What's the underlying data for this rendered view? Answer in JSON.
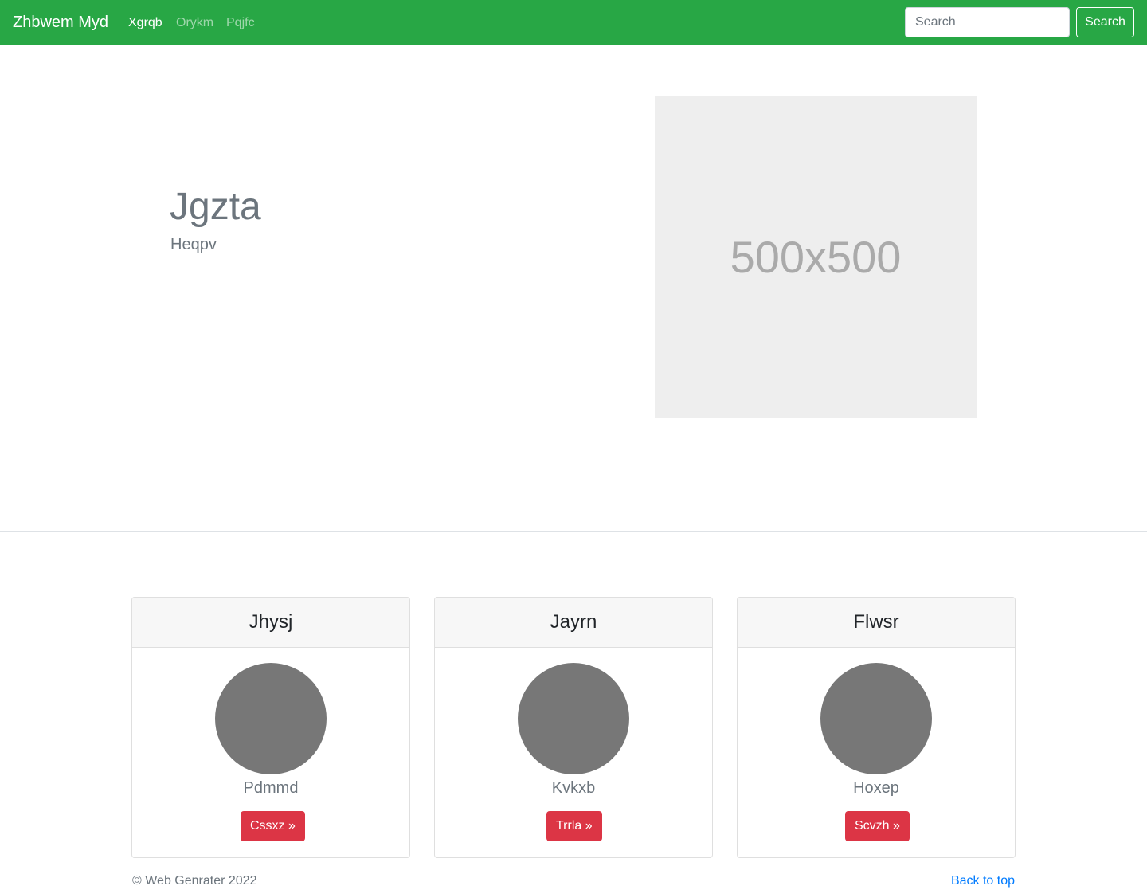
{
  "navbar": {
    "brand": "Zhbwem Myd",
    "links": [
      {
        "label": "Xgrqb",
        "active": true
      },
      {
        "label": "Orykm",
        "active": false
      },
      {
        "label": "Pqjfc",
        "active": false
      }
    ],
    "search_placeholder": "Search",
    "search_button": "Search",
    "color": "#28a745"
  },
  "hero": {
    "title": "Jgzta",
    "subtitle": "Heqpv",
    "image_label": "500x500"
  },
  "cards": [
    {
      "title": "Jhysj",
      "name": "Pdmmd",
      "button": "Cssxz »"
    },
    {
      "title": "Jayrn",
      "name": "Kvkxb",
      "button": "Trrla »"
    },
    {
      "title": "Flwsr",
      "name": "Hoxep",
      "button": "Scvzh »"
    }
  ],
  "footer": {
    "copyright": "© Web Genrater 2022",
    "back_to_top": "Back to top"
  }
}
